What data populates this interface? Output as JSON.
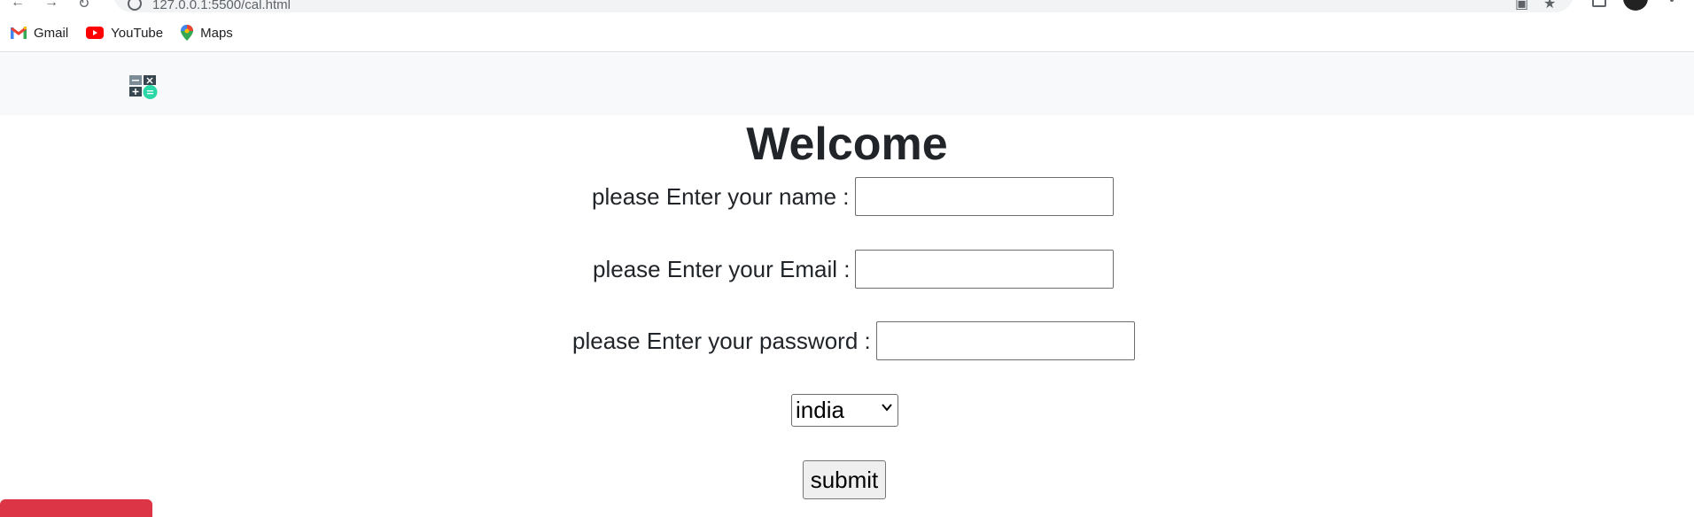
{
  "browser": {
    "url": "127.0.0.1:5500/cal.html",
    "bookmarks": [
      {
        "label": "Gmail",
        "icon": "gmail-icon"
      },
      {
        "label": "YouTube",
        "icon": "youtube-icon"
      },
      {
        "label": "Maps",
        "icon": "maps-icon"
      }
    ]
  },
  "navbar": {
    "logo_icon": "calculator-icon"
  },
  "form": {
    "title": "Welcome",
    "name_label": "please Enter your name :",
    "email_label": "please Enter your Email :",
    "password_label": "please Enter your password :",
    "name_value": "",
    "email_value": "",
    "password_value": "",
    "country_selected": "india",
    "submit_label": "submit"
  },
  "colors": {
    "navbar_bg": "#f8f9fa",
    "accent_red": "#dc3545",
    "logo_teal": "#2bd8a7"
  }
}
